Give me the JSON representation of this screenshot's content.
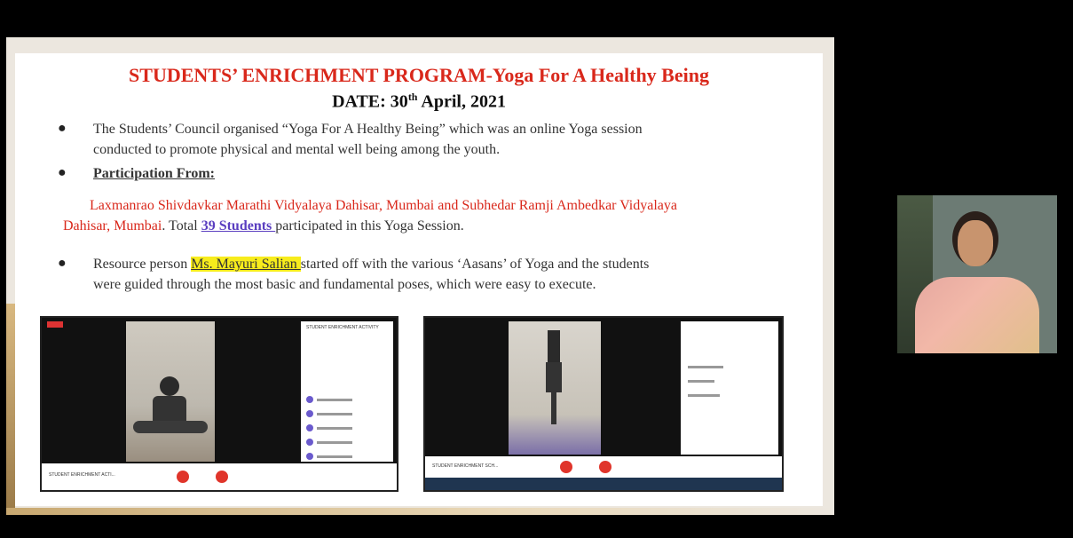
{
  "slide": {
    "title": "STUDENTS’ ENRICHMENT PROGRAM-Yoga For A Healthy Being",
    "date_prefix": "DATE: 30",
    "date_sup": "th",
    "date_suffix": " April, 2021",
    "bullet1_line1": "The Students’ Council organised “Yoga For A Healthy Being” which was an online Yoga session",
    "bullet1_line2": "conducted to promote physical and mental well being among the youth.",
    "bullet2": "Participation From:",
    "participants_line1": "Laxmanrao Shivdavkar Marathi Vidyalaya Dahisar, Mumbai and Subhedar Ramji Ambedkar Vidyalaya",
    "participants_line2_red": "Dahisar, Mumbai",
    "participants_line2_pre": ". Total ",
    "participants_count": "39 Students ",
    "participants_line2_post": "participated in this Yoga Session.",
    "bullet3_pre": "Resource person ",
    "resource_person": "Ms. Mayuri Salian ",
    "bullet3_post": "started off with the various ‘Aasans’ of Yoga  and the students",
    "bullet3_line2": "were guided through the most basic and fundamental poses, which were easy to execute."
  },
  "screenshot1": {
    "panel_title": "STUDENT ENRICHMENT ACTIVITY",
    "bottom_label": "STUDENT ENRICHMENT ACTI..."
  },
  "screenshot2": {
    "bottom_label": "STUDENT ENRICHMENT SCH..."
  },
  "colors": {
    "title_red": "#d9281b",
    "highlight": "#f7ec1c",
    "link_purple": "#5a3ec0"
  }
}
